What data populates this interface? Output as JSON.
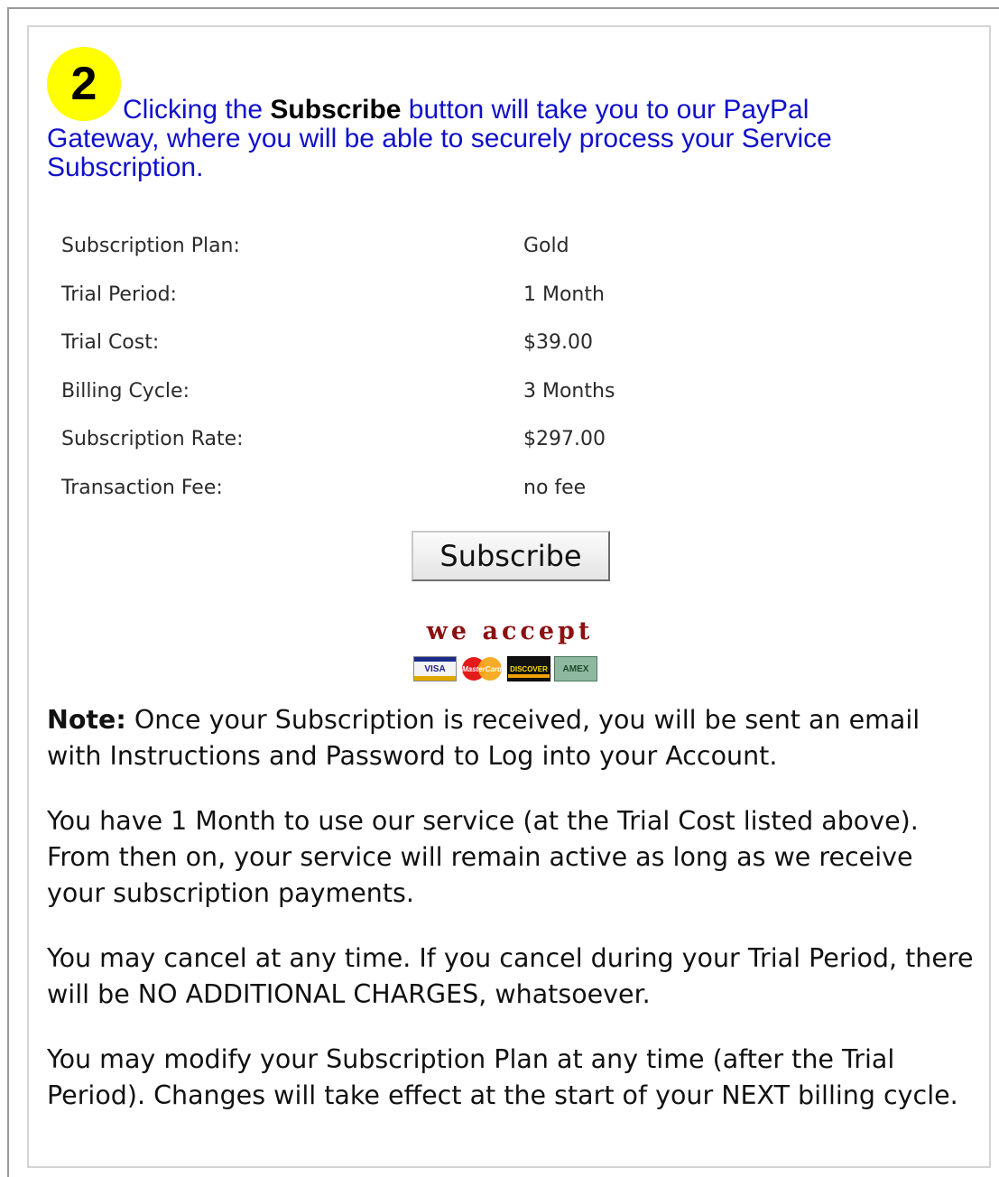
{
  "step": {
    "number": "2"
  },
  "intro": {
    "text_before": "Clicking the ",
    "button_word": "Subscribe",
    "text_after": " button will take you to our PayPal Gateway, where you will be able to securely process your Service Subscription."
  },
  "plan_details": [
    {
      "label": "Subscription Plan:",
      "value": "Gold"
    },
    {
      "label": "Trial Period:",
      "value": "1 Month"
    },
    {
      "label": "Trial Cost:",
      "value": "$39.00"
    },
    {
      "label": "Billing Cycle:",
      "value": "3 Months"
    },
    {
      "label": "Subscription Rate:",
      "value": "$297.00"
    },
    {
      "label": "Transaction Fee:",
      "value": "no fee"
    }
  ],
  "subscribe_button": {
    "label": "Subscribe"
  },
  "payment": {
    "we_accept": "we accept",
    "cards": [
      {
        "name": "visa-card-icon",
        "text": "VISA"
      },
      {
        "name": "mastercard-icon",
        "text": "MasterCard"
      },
      {
        "name": "discover-card-icon",
        "text": "DISCOVER"
      },
      {
        "name": "amex-card-icon",
        "text": "AMEX"
      }
    ]
  },
  "notes": {
    "note_label": "Note:",
    "note_text": " Once your Subscription is received, you will be sent an email with Instructions and Password to Log into your Account.",
    "paragraph_trial": "You have 1 Month to use our service (at the Trial Cost listed above). From then on, your service will remain active as long as we receive your subscription payments.",
    "paragraph_cancel": "You may cancel at any time. If you cancel during your Trial Period, there will be NO ADDITIONAL CHARGES, whatsoever.",
    "paragraph_modify": "You may modify your Subscription Plan at any time (after the Trial Period). Changes will take effect at the start of your NEXT billing cycle."
  },
  "colors": {
    "badge": "#ffff00",
    "intro_text": "#1010cc",
    "we_accept": "#8c1010"
  }
}
